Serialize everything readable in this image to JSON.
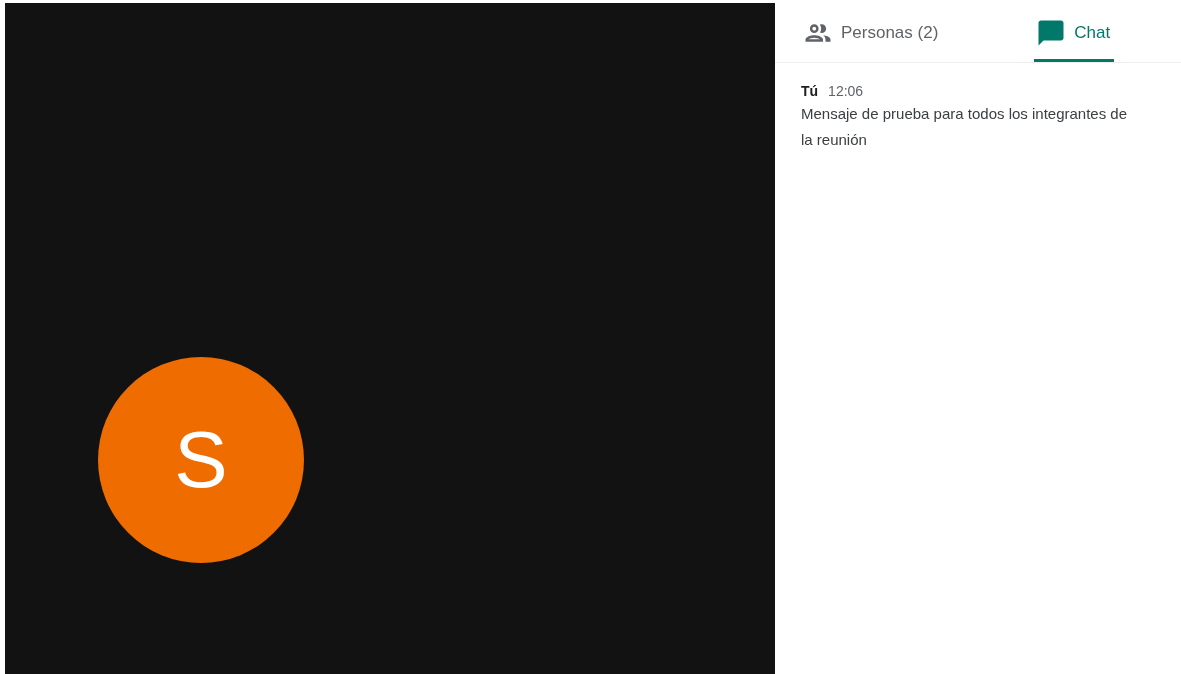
{
  "video": {
    "avatar_letter": "S"
  },
  "tabs": [
    {
      "label": "Personas (2)",
      "kind": "people",
      "selected": false
    },
    {
      "label": "Chat",
      "kind": "chat",
      "selected": true
    }
  ],
  "messages": [
    {
      "sender": "Tú",
      "time": "12:06",
      "text": "Mensaje de prueba para todos los integrantes de la reunión"
    }
  ]
}
